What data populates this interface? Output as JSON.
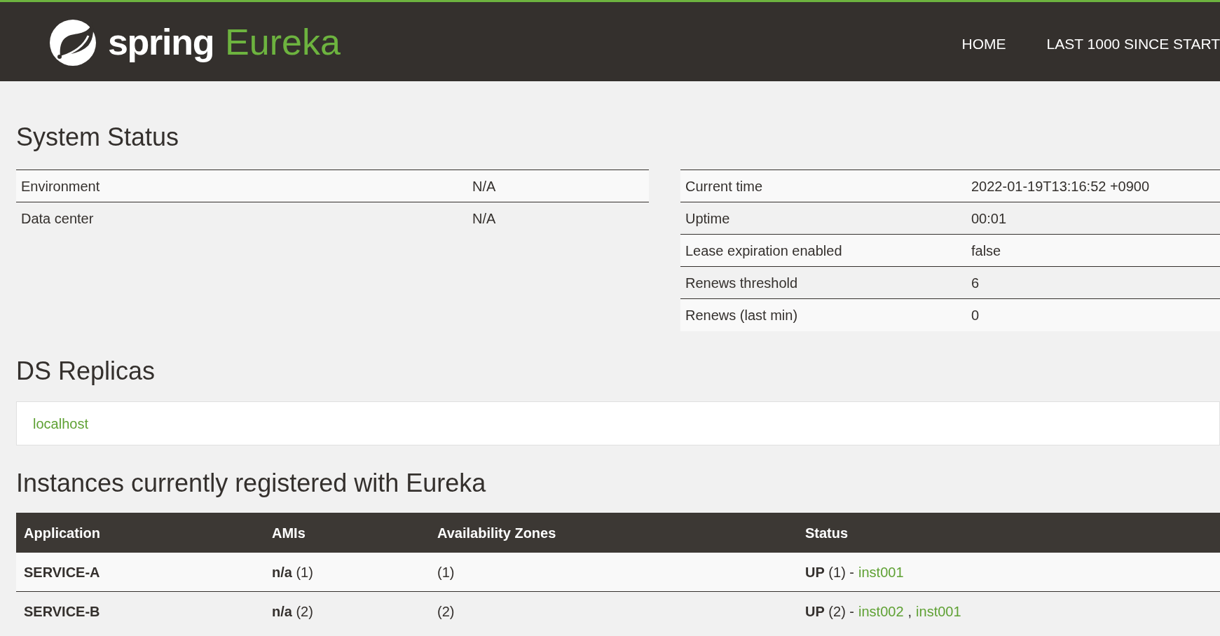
{
  "header": {
    "brand": "spring",
    "product": "Eureka",
    "nav": [
      {
        "label": "HOME"
      },
      {
        "label": "LAST 1000 SINCE START"
      }
    ]
  },
  "system_status": {
    "title": "System Status",
    "left": [
      {
        "label": "Environment",
        "value": "N/A"
      },
      {
        "label": "Data center",
        "value": "N/A"
      }
    ],
    "right": [
      {
        "label": "Current time",
        "value": "2022-01-19T13:16:52 +0900"
      },
      {
        "label": "Uptime",
        "value": "00:01"
      },
      {
        "label": "Lease expiration enabled",
        "value": "false"
      },
      {
        "label": "Renews threshold",
        "value": "6"
      },
      {
        "label": "Renews (last min)",
        "value": "0"
      }
    ]
  },
  "ds_replicas": {
    "title": "DS Replicas",
    "items": [
      "localhost"
    ]
  },
  "instances": {
    "title": "Instances currently registered with Eureka",
    "columns": [
      "Application",
      "AMIs",
      "Availability Zones",
      "Status"
    ],
    "rows": [
      {
        "application": "SERVICE-A",
        "amis": "**n/a** (1)",
        "zones": "(1)",
        "status": "**UP** (1) -",
        "links": [
          "inst001"
        ]
      },
      {
        "application": "SERVICE-B",
        "amis": "**n/a** (2)",
        "zones": "(2)",
        "status": "**UP** (2) -",
        "links": [
          "inst002",
          "inst001"
        ],
        "separator": ","
      }
    ]
  }
}
